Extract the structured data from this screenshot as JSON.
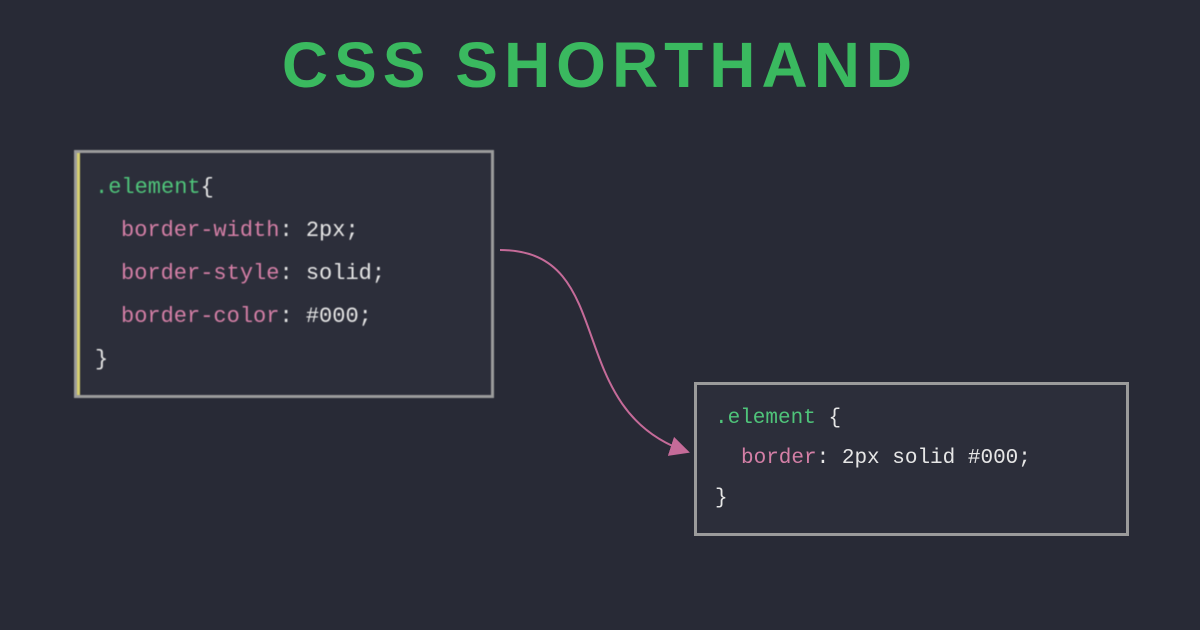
{
  "title": "CSS SHORTHAND",
  "longhand": {
    "selector": ".element",
    "open": "{",
    "close": "}",
    "decls": [
      {
        "prop": "border-width",
        "value": "2px"
      },
      {
        "prop": "border-style",
        "value": "solid"
      },
      {
        "prop": "border-color",
        "value": "#000"
      }
    ]
  },
  "shorthand": {
    "selector": ".element",
    "open": "{",
    "close": "}",
    "decl": {
      "prop": "border",
      "value": "2px solid #000"
    }
  },
  "colors": {
    "bg": "#282a36",
    "title": "#3ab95f",
    "selector": "#4fc47a",
    "prop": "#d47fa6",
    "arrow": "#c56b99"
  }
}
